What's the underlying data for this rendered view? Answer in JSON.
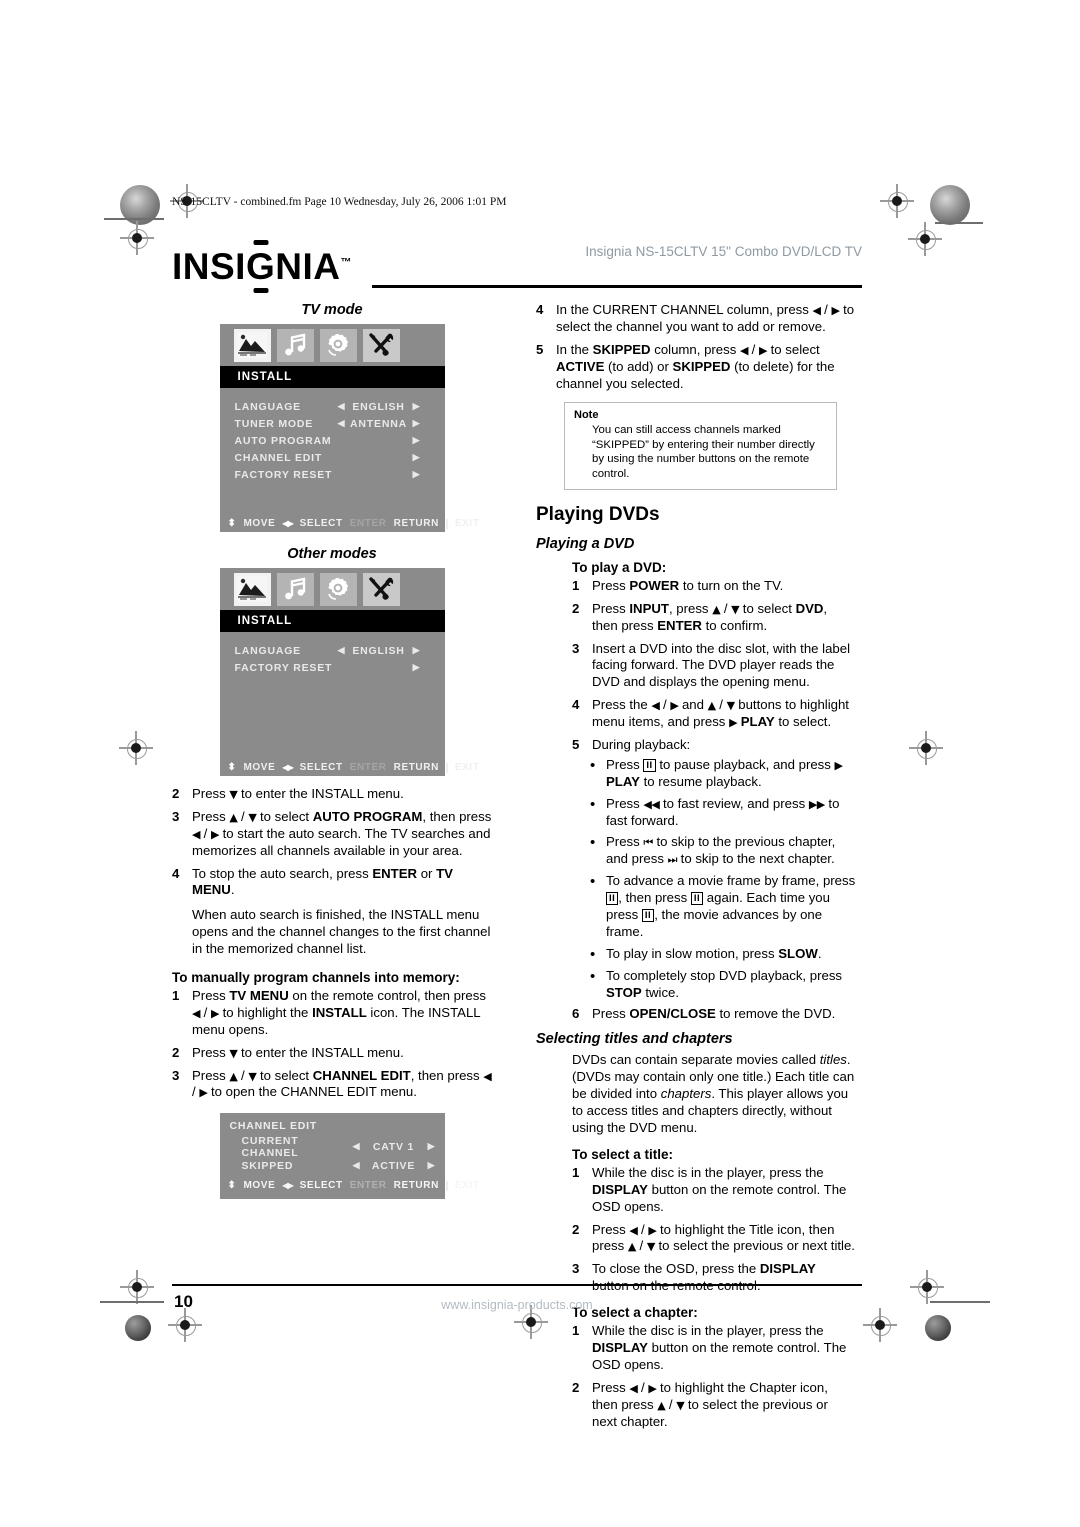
{
  "fm_line": "NS-15CLTV - combined.fm  Page 10  Wednesday, July 26, 2006  1:01 PM",
  "brand": {
    "logo_part1": "INSI",
    "logo_letter_g": "G",
    "logo_part2": "NIA",
    "trademark": "™"
  },
  "header": {
    "title": "Insignia NS-15CLTV 15\" Combo DVD/LCD TV"
  },
  "osd_tv_mode": {
    "caption": "TV mode",
    "icons": [
      "picture-icon",
      "music-icon",
      "gear-icon",
      "tools-icon"
    ],
    "active_icon": "tools-icon",
    "menu_title": "INSTALL",
    "rows": [
      {
        "label": "LANGUAGE",
        "left_arrow": "◀",
        "value": "ENGLISH",
        "right_arrow": "▶"
      },
      {
        "label": "TUNER MODE",
        "left_arrow": "◀",
        "value": "ANTENNA",
        "right_arrow": "▶"
      },
      {
        "label": "AUTO PROGRAM",
        "left_arrow": "",
        "value": "",
        "right_arrow": "▶"
      },
      {
        "label": "CHANNEL  EDIT",
        "left_arrow": "",
        "value": "",
        "right_arrow": "▶"
      },
      {
        "label": "FACTORY RESET",
        "left_arrow": "",
        "value": "",
        "right_arrow": "▶"
      }
    ],
    "footer": {
      "move": "MOVE",
      "select": "SELECT",
      "enter": "ENTER",
      "return": "RETURN",
      "exit": "EXIT"
    }
  },
  "osd_other_modes": {
    "caption": "Other modes",
    "menu_title": "INSTALL",
    "rows": [
      {
        "label": "LANGUAGE",
        "left_arrow": "◀",
        "value": "ENGLISH",
        "right_arrow": "▶"
      },
      {
        "label": "FACTORY RESET",
        "left_arrow": "",
        "value": "",
        "right_arrow": "▶"
      }
    ],
    "footer": {
      "move": "MOVE",
      "select": "SELECT",
      "enter": "ENTER",
      "return": "RETURN",
      "exit": "EXIT"
    }
  },
  "osd_channel_edit": {
    "title": "CHANNEL EDIT",
    "rows": [
      {
        "label": "CURRENT CHANNEL",
        "left_arrow": "◀",
        "value": "CATV 1",
        "right_arrow": "▶"
      },
      {
        "label": "SKIPPED",
        "left_arrow": "◀",
        "value": "ACTIVE",
        "right_arrow": "▶"
      }
    ],
    "footer": {
      "move": "MOVE",
      "select": "SELECT",
      "enter": "ENTER",
      "return": "RETURN",
      "exit": "EXIT"
    }
  },
  "left_column": {
    "auto_steps": [
      {
        "num": "2",
        "html": "Press <span class=\"key\">▼</span> to enter the INSTALL menu."
      },
      {
        "num": "3",
        "html": "Press <span class=\"key\">▲</span> / <span class=\"key\">▼</span> to select <b>AUTO PROGRAM</b>, then press <span class=\"key\">◀</span> / <span class=\"key\">▶</span> to start the auto search. The TV searches and memorizes all channels available in your area."
      },
      {
        "num": "4",
        "html": "To stop the auto search, press <b>ENTER</b> or <b>TV MENU</b>."
      }
    ],
    "auto_followup": "When auto search is finished, the INSTALL menu opens and the channel changes to the first channel in the memorized channel list.",
    "manual_heading": "To manually program channels into memory:",
    "manual_steps": [
      {
        "num": "1",
        "html": "Press <b>TV MENU</b> on the remote control, then press <span class=\"key\">◀</span> / <span class=\"key\">▶</span> to highlight the <b>INSTALL</b> icon. The INSTALL menu opens."
      },
      {
        "num": "2",
        "html": "Press <span class=\"key\">▼</span> to enter the INSTALL menu."
      },
      {
        "num": "3",
        "html": "Press <span class=\"key\">▲</span> / <span class=\"key\">▼</span> to select <b>CHANNEL EDIT</b>, then press <span class=\"key\">◀</span> / <span class=\"key\">▶</span> to open the CHANNEL EDIT menu."
      }
    ]
  },
  "right_column": {
    "top_steps": [
      {
        "num": "4",
        "html": "In the CURRENT CHANNEL column, press <span class=\"key\">◀</span> / <span class=\"key\">▶</span> to select the channel you want to add or remove."
      },
      {
        "num": "5",
        "html": "In the <b>SKIPPED</b> column, press <span class=\"key\">◀</span> / <span class=\"key\">▶</span> to select <b>ACTIVE</b> (to add) or <b>SKIPPED</b> (to delete) for the channel you selected."
      }
    ],
    "note": {
      "label": "Note",
      "text": "You can still access channels marked “SKIPPED” by entering their number directly by using the number buttons on the remote control."
    },
    "section_title": "Playing DVDs",
    "sub_title": "Playing a DVD",
    "play_heading": "To play a DVD:",
    "play_steps": [
      {
        "num": "1",
        "html": "Press <b>POWER</b> to turn on the TV."
      },
      {
        "num": "2",
        "html": "Press <b>INPUT</b>, press <span class=\"key\">▲</span> / <span class=\"key\">▼</span> to select <b>DVD</b>, then press <b>ENTER</b> to confirm."
      },
      {
        "num": "3",
        "html": "Insert a DVD into the disc slot, with the label facing forward. The DVD player reads the DVD and displays the opening menu."
      },
      {
        "num": "4",
        "html": "Press the <span class=\"key\">◀</span> / <span class=\"key\">▶</span> and <span class=\"key\">▲</span> / <span class=\"key\">▼</span> buttons to highlight menu items, and press <span class=\"key\">▶</span> <b>PLAY</b> to select."
      },
      {
        "num": "5",
        "html": "During playback:"
      }
    ],
    "playback_bullets": [
      "Press <span class=\"pausebox\">II</span> to pause playback, and press <span class=\"key\">▶</span> <b>PLAY</b> to resume playback.",
      "Press <span class=\"key\">◀◀</span> to fast review, and press <span class=\"key\">▶▶</span> to fast forward.",
      "Press <span class=\"key\">⏮</span> to skip to the previous chapter, and press <span class=\"key\">⏭</span> to skip to the next chapter.",
      "To advance a movie frame by frame, press <span class=\"pausebox\">II</span>, then press <span class=\"pausebox\">II</span> again. Each time you press <span class=\"pausebox\">II</span>, the movie advances by one frame.",
      "To play in slow motion, press <b>SLOW</b>.",
      "To completely stop DVD playback, press <b>STOP</b> twice."
    ],
    "final_step": {
      "num": "6",
      "html": "Press <b>OPEN/CLOSE</b> to remove the DVD."
    },
    "titles_chapters_heading": "Selecting titles and chapters",
    "titles_chapters_para": "DVDs can contain separate movies called <i>titles</i>. (DVDs may contain only one title.) Each title can be divided into <i>chapters</i>. This player allows you to access titles and chapters directly, without using the DVD menu.",
    "select_title_heading": "To select a title:",
    "select_title_steps": [
      {
        "num": "1",
        "html": "While the disc is in the player, press the <b>DISPLAY</b> button on the remote control. The OSD opens."
      },
      {
        "num": "2",
        "html": "Press <span class=\"key\">◀</span> / <span class=\"key\">▶</span> to highlight the Title icon, then press <span class=\"key\">▲</span> / <span class=\"key\">▼</span> to select the previous or next title."
      },
      {
        "num": "3",
        "html": "To close the OSD, press the <b>DISPLAY</b> button on the remote control."
      }
    ],
    "select_chapter_heading": "To select a chapter:",
    "select_chapter_steps": [
      {
        "num": "1",
        "html": "While the disc is in the player, press the <b>DISPLAY</b> button on the remote control. The OSD opens."
      },
      {
        "num": "2",
        "html": "Press <span class=\"key\">◀</span> / <span class=\"key\">▶</span> to highlight the Chapter icon, then press <span class=\"key\">▲</span> / <span class=\"key\">▼</span> to select the previous or next chapter."
      }
    ]
  },
  "footer": {
    "page_number": "10",
    "url": "www.insignia-products.com"
  },
  "colors": {
    "header_title": "#8d9aa3",
    "footer_url": "#b3bcc2",
    "osd_background": "#8b8b8b",
    "osd_title_bar": "#000000",
    "icon_tile": "#b4b4b4",
    "icon_tile_active": "#c9c9c9"
  }
}
